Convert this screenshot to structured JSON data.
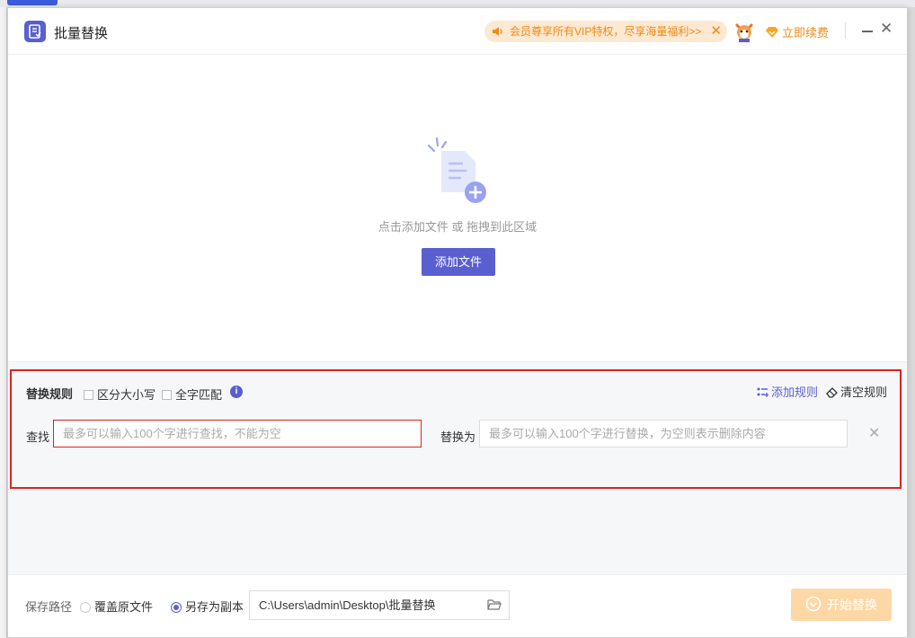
{
  "dialog": {
    "title": "批量替换",
    "vip_banner": "会员尊享所有VIP特权，尽享海量福利>>",
    "renew_label": "立即续费"
  },
  "drop_area": {
    "hint": "点击添加文件 或 拖拽到此区域",
    "add_file_label": "添加文件"
  },
  "rules": {
    "title": "替换规则",
    "case_sensitive_label": "区分大小写",
    "case_sensitive_checked": false,
    "whole_word_label": "全字匹配",
    "whole_word_checked": false,
    "info_glyph": "i",
    "add_rule_label": "添加规则",
    "clear_rules_label": "清空规则",
    "find_label": "查找",
    "find_placeholder": "最多可以输入100个字进行查找，不能为空",
    "find_value": "",
    "replace_label": "替换为",
    "replace_placeholder": "最多可以输入100个字进行替换，为空则表示删除内容",
    "replace_value": ""
  },
  "footer": {
    "save_path_label": "保存路径",
    "option_overwrite": "覆盖原文件",
    "option_copy": "另存为副本",
    "selected_option": "另存为副本",
    "path_value": "C:\\Users\\admin\\Desktop\\批量替换",
    "start_label": "开始替换"
  },
  "colors": {
    "accent": "#5a5fd0",
    "vip_orange": "#f08a16",
    "vip_bg": "#fde9d2",
    "error_red": "#e02020",
    "start_disabled": "#fdd8a6"
  },
  "icons": [
    "app-icon",
    "speaker-icon",
    "close-icon",
    "mascot-avatar",
    "diamond-icon",
    "minimize-icon",
    "file-add-icon",
    "info-icon",
    "add-rule-icon",
    "eraser-icon",
    "folder-open-icon",
    "check-circle-icon"
  ]
}
